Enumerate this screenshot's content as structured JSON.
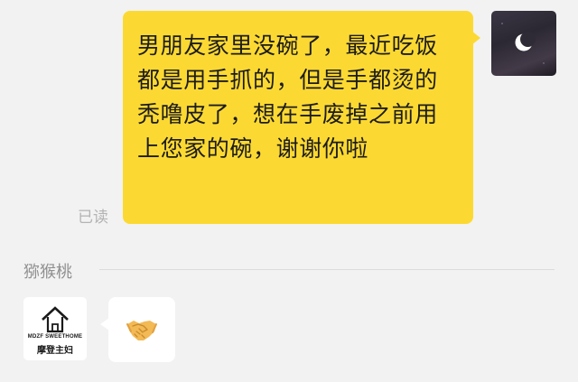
{
  "outgoing_message": {
    "text": "男朋友家里没碗了，最近吃饭都是用手抓的，但是手都烫的秃噜皮了，想在手废掉之前用上您家的碗，谢谢你啦",
    "read_status": "已读",
    "bubble_color": "#fcd932",
    "avatar_icon": "crescent-moon-night-sky-icon"
  },
  "incoming_message": {
    "sender_name": "猕猴桃",
    "avatar": {
      "icon": "house-logo-icon",
      "brand_en": "MDZF SWEETHOME",
      "brand_cn": "摩登主妇"
    },
    "content_icon": "handshake-emoji-icon"
  }
}
